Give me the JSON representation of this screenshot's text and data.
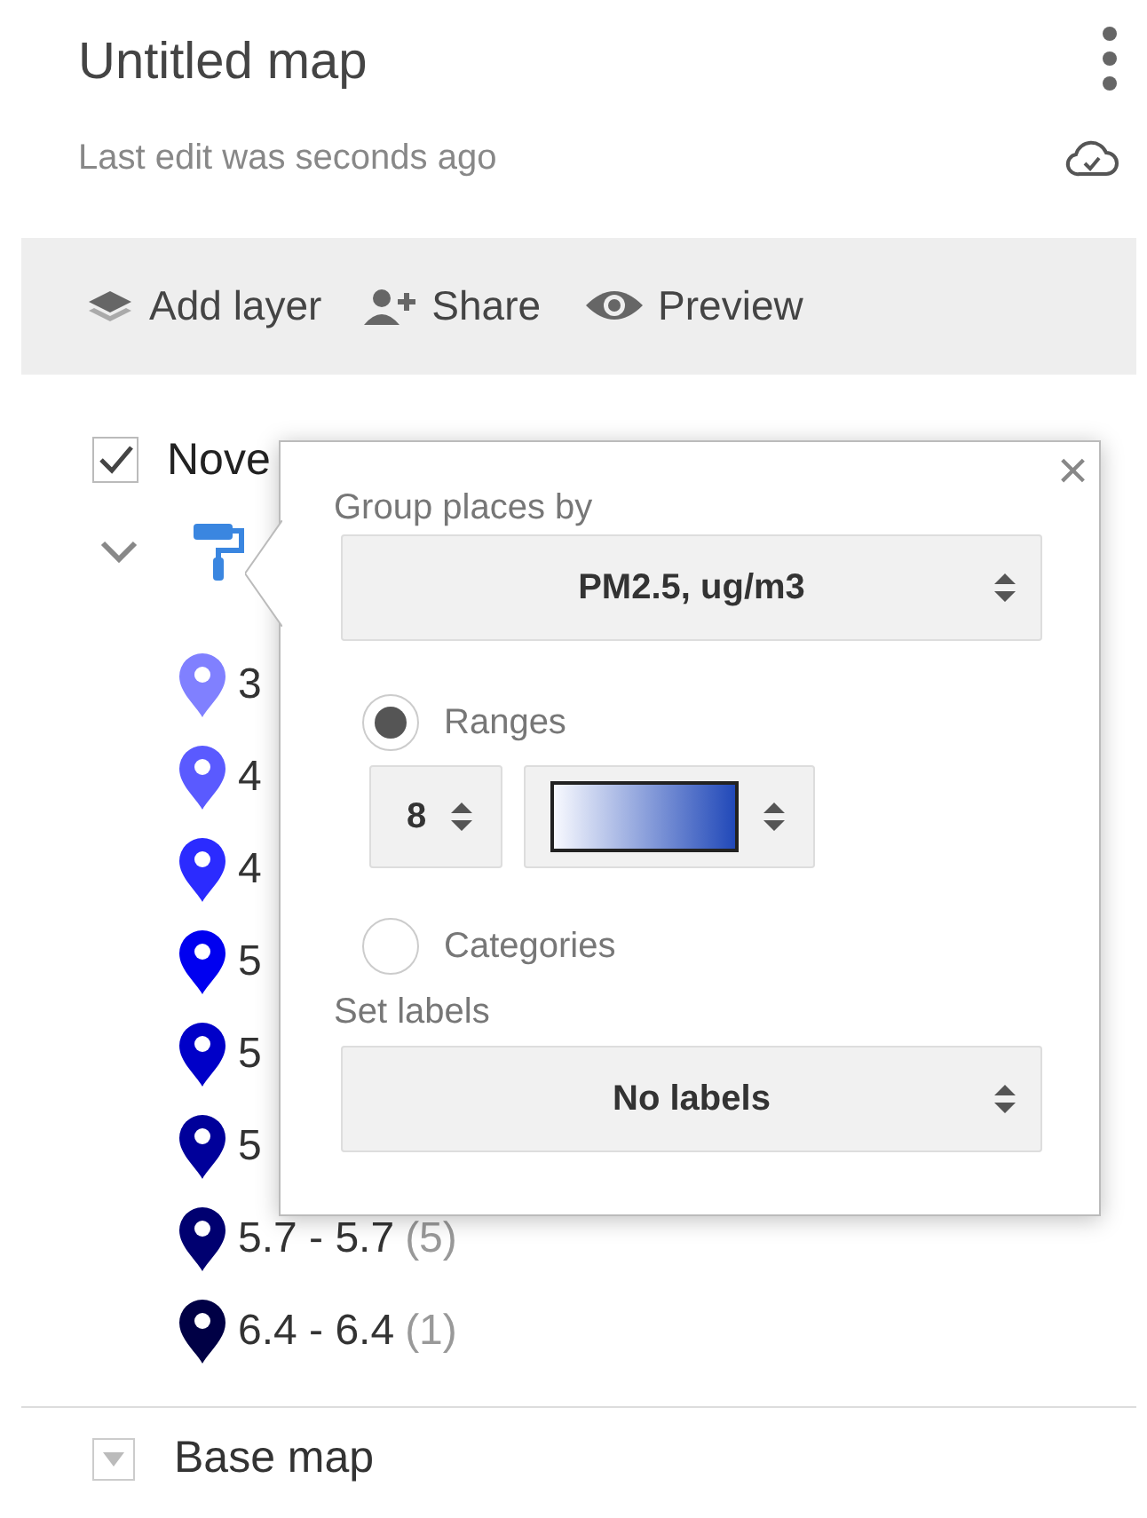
{
  "map": {
    "title": "Untitled map",
    "subtitle": "Last edit was seconds ago"
  },
  "toolbar": [
    {
      "kind": "layers",
      "label": "Add layer"
    },
    {
      "kind": "share",
      "label": "Share"
    },
    {
      "kind": "preview",
      "label": "Preview"
    }
  ],
  "layer": {
    "title": "Nove",
    "checked": true,
    "expanded": true,
    "items": [
      {
        "label": "3",
        "color": "#8080ff"
      },
      {
        "label": "4",
        "color": "#5a5aff"
      },
      {
        "label": "4",
        "color": "#2b2bff"
      },
      {
        "label": "5",
        "color": "#0000f0"
      },
      {
        "label": "5",
        "color": "#0000c8"
      },
      {
        "label": "5",
        "color": "#00009a"
      },
      {
        "label": "5.7 - 5.7",
        "count": "(5)",
        "color": "#000070"
      },
      {
        "label": "6.4 - 6.4",
        "count": "(1)",
        "color": "#000045"
      }
    ]
  },
  "base_map": {
    "label": "Base map",
    "expanded": false
  },
  "popover": {
    "group_label": "Group places by",
    "group_value": "PM2.5, ug/m3",
    "options": [
      {
        "label": "Ranges",
        "selected": true
      },
      {
        "label": "Categories",
        "selected": false
      }
    ],
    "range_count": "8",
    "labels_label": "Set labels",
    "labels_value": "No labels",
    "close": "×"
  }
}
